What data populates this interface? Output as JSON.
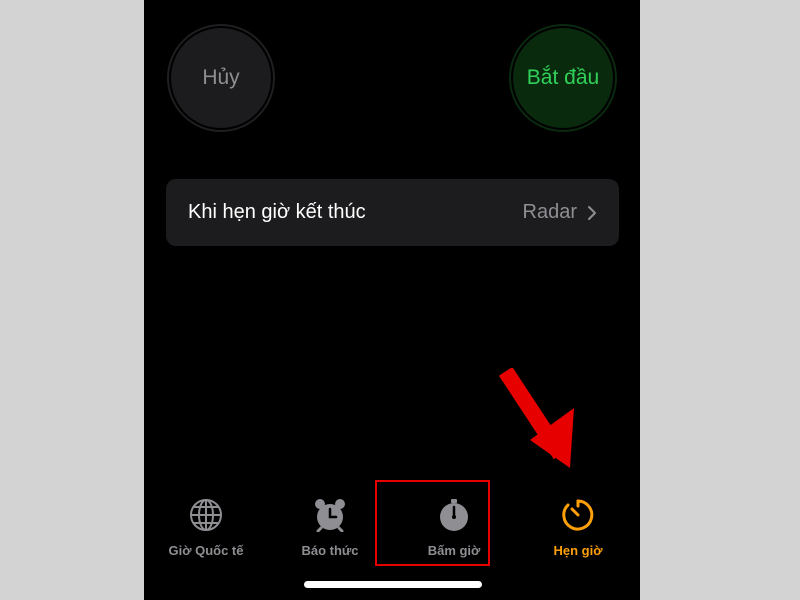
{
  "buttons": {
    "cancel_label": "Hủy",
    "start_label": "Bắt đầu"
  },
  "setting_row": {
    "label": "Khi hẹn giờ kết thúc",
    "value": "Radar"
  },
  "tabs": [
    {
      "label": "Giờ Quốc tế",
      "icon": "globe-icon"
    },
    {
      "label": "Báo thức",
      "icon": "alarm-clock-icon"
    },
    {
      "label": "Bấm giờ",
      "icon": "stopwatch-icon"
    },
    {
      "label": "Hẹn giờ",
      "icon": "timer-icon",
      "active": true
    }
  ],
  "colors": {
    "accent_active": "#ff9f0a",
    "start_text": "#30d158",
    "highlight": "#e60000",
    "background": "#000000"
  }
}
